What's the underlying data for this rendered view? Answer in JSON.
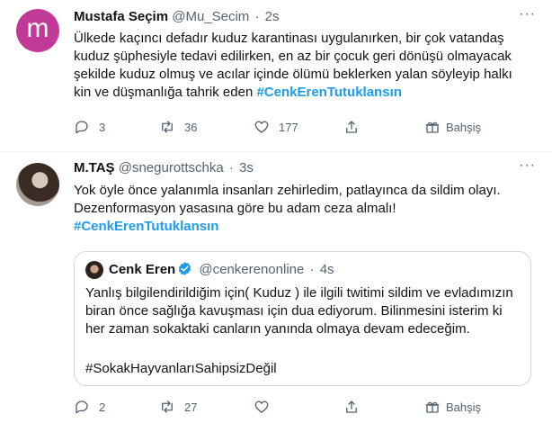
{
  "tweets": [
    {
      "author": {
        "name": "Mustafa Seçim",
        "handle": "@Mu_Secim",
        "avatar_letter": "m",
        "avatar_color": "#c13a97"
      },
      "time": "2s",
      "text": "Ülkede kaçıncı defadır kuduz karantinası uygulanırken, bir çok vatandaş kuduz şüphesiyle tedavi edilirken, en az bir çocuk geri dönüşü olmayacak şekilde kuduz olmuş ve acılar içinde ölümü beklerken yalan söyleyip halkı kin ve düşmanlığa tahrik eden",
      "hashtag": "#CenkErenTutuklansın",
      "actions": {
        "replies": "3",
        "retweets": "36",
        "likes": "177",
        "tip_label": "Bahşiş"
      }
    },
    {
      "author": {
        "name": "M.TAŞ",
        "handle": "@snegurottschka"
      },
      "time": "3s",
      "text_line1": "Yok öyle önce yalanımla insanları zehirledim, patlayınca da sildim olayı.",
      "text_line2": "Dezenformasyon yasasına göre bu adam ceza almalı!",
      "hashtag": "#CenkErenTutuklansın",
      "quote": {
        "author": {
          "name": "Cenk Eren",
          "handle": "@cenkerenonline",
          "verified": true
        },
        "time": "4s",
        "text": "Yanlış bilgilendirildiğim için( Kuduz ) ile ilgili twitimi sildim ve evladımızın biran önce sağlığa kavuşması için dua ediyorum. Bilinmesini isterim ki her zaman sokaktaki canların yanında olmaya devam edeceğim.",
        "hashtag": "#SokakHayvanlarıSahipsizDeğil"
      },
      "actions": {
        "replies": "2",
        "retweets": "27",
        "likes": "",
        "tip_label": "Bahşiş"
      }
    }
  ],
  "ui": {
    "more_label": "···",
    "dot": "·"
  },
  "colors": {
    "accent": "#1d9bf0",
    "text": "#0f1419",
    "muted": "#536471",
    "border": "#cfd9de"
  }
}
